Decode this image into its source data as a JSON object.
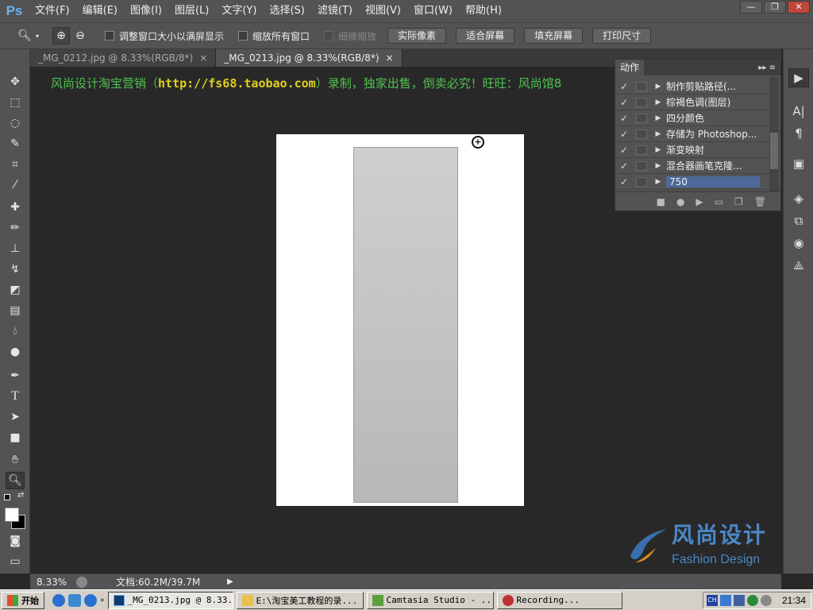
{
  "app": {
    "logo": "Ps"
  },
  "menu": [
    "文件(F)",
    "编辑(E)",
    "图像(I)",
    "图层(L)",
    "文字(Y)",
    "选择(S)",
    "滤镜(T)",
    "视图(V)",
    "窗口(W)",
    "帮助(H)"
  ],
  "window_controls": {
    "minimize": "—",
    "restore": "❐",
    "close": "✕"
  },
  "options": {
    "check_resize": "调整窗口大小以满屏显示",
    "check_zoom_all": "缩放所有窗口",
    "check_scrubby": "细微缩放",
    "btn_actual": "实际像素",
    "btn_fit": "适合屏幕",
    "btn_fill": "填充屏幕",
    "btn_print": "打印尺寸"
  },
  "tabs": [
    {
      "label": "_MG_0212.jpg @ 8.33%(RGB/8*)",
      "close": "×"
    },
    {
      "label": "_MG_0213.jpg @ 8.33%(RGB/8*)",
      "close": "×"
    }
  ],
  "canvas": {
    "watermark_prefix": "风尚设计淘宝营销（",
    "watermark_url": "http://fs68.taobao.com",
    "watermark_suffix": "）录制，独家出售，倒卖必究！旺旺：风尚馆8",
    "zoom_cursor_glyph": "+"
  },
  "brand": {
    "zh": "风尚设计",
    "en": "Fashion Design"
  },
  "actions": {
    "title": "动作",
    "menu_glyph": "▸▸ ≡",
    "rows": [
      {
        "check": "✓",
        "name": "制作剪贴路径(..."
      },
      {
        "check": "✓",
        "name": "棕褐色调(图层)"
      },
      {
        "check": "✓",
        "name": "四分颜色"
      },
      {
        "check": "✓",
        "name": "存储为 Photoshop..."
      },
      {
        "check": "✓",
        "name": "渐变映射"
      },
      {
        "check": "✓",
        "name": "混合器画笔克隆..."
      },
      {
        "check": "✓",
        "name": "750"
      }
    ],
    "footer": [
      "■",
      "●",
      "▶",
      "▭",
      "❐",
      "🗑"
    ]
  },
  "status": {
    "zoom": "8.33%",
    "doc": "文档:60.2M/39.7M",
    "arrow": "▶"
  },
  "taskbar": {
    "start": "开始",
    "tasks": [
      "_MG_0213.jpg @ 8.33...",
      "E:\\淘宝美工教程的录...",
      "Camtasia Studio - ...",
      "Recording..."
    ],
    "clock": "21:34"
  },
  "colors": {
    "panel": "#535353",
    "canvas": "#282828",
    "watermark": "#4ec34e",
    "url": "#e0d020",
    "brand": "#4b87c8",
    "selected": "#4d6a9a"
  }
}
